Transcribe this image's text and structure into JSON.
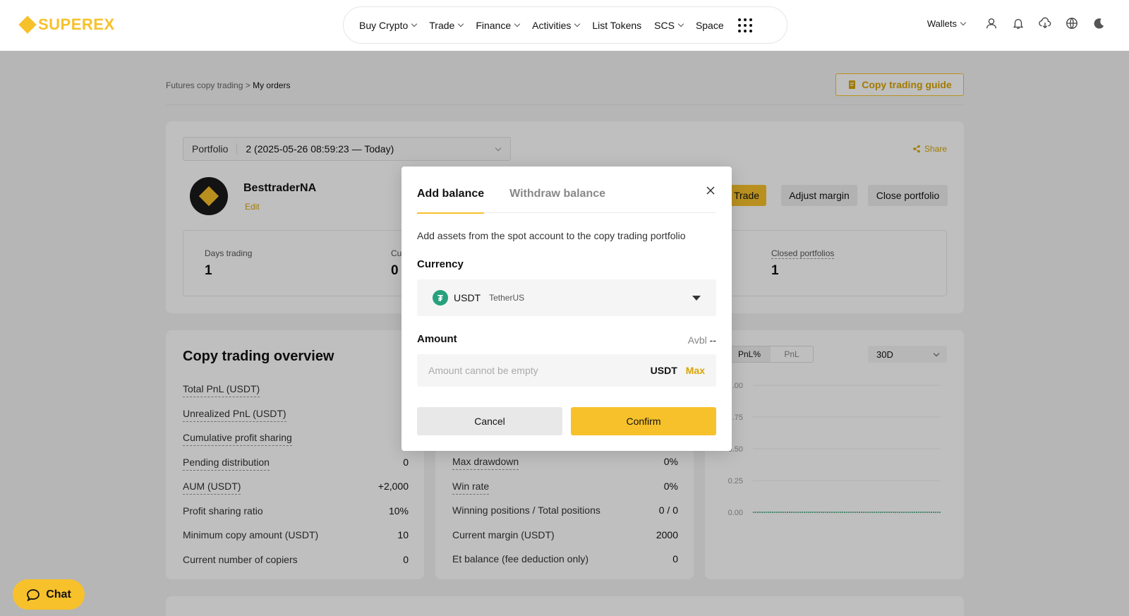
{
  "brand": {
    "name": "SUPEREX",
    "color": "#f7c12b"
  },
  "nav": {
    "items": [
      {
        "label": "Buy Crypto",
        "dropdown": true
      },
      {
        "label": "Trade",
        "dropdown": true
      },
      {
        "label": "Finance",
        "dropdown": true
      },
      {
        "label": "Activities",
        "dropdown": true
      },
      {
        "label": "List Tokens",
        "dropdown": false
      },
      {
        "label": "SCS",
        "dropdown": true
      },
      {
        "label": "Space",
        "dropdown": false
      }
    ],
    "wallets_label": "Wallets",
    "icons": [
      "user-icon",
      "bell-icon",
      "download-icon",
      "globe-icon",
      "moon-icon"
    ]
  },
  "breadcrumb": {
    "parent": "Futures copy trading",
    "sep": ">",
    "current": "My orders"
  },
  "guide_button": "Copy trading guide",
  "portfolio": {
    "label": "Portfolio",
    "value": "2  (2025-05-26 08:59:23 — Today)",
    "share": "Share"
  },
  "trader": {
    "name": "BesttraderNA",
    "edit": "Edit",
    "buttons": {
      "trade": "Trade",
      "adjust": "Adjust margin",
      "close": "Close portfolio"
    }
  },
  "stats": {
    "days_trading": {
      "label": "Days trading",
      "value": "1"
    },
    "current": {
      "label": "Cu",
      "value": "0"
    },
    "closed": {
      "label": "Closed portfolios",
      "value": "1"
    }
  },
  "overview": {
    "title": "Copy trading overview",
    "left_rows": [
      {
        "label": "Total PnL (USDT)",
        "value": "",
        "underline": true
      },
      {
        "label": "Unrealized PnL (USDT)",
        "value": "",
        "underline": true
      },
      {
        "label": "Cumulative profit sharing",
        "value": "",
        "underline": true
      },
      {
        "label": "Pending distribution",
        "value": "0",
        "underline": true
      },
      {
        "label": "AUM (USDT)",
        "value": "+2,000",
        "underline": true
      },
      {
        "label": "Profit sharing ratio",
        "value": "10%",
        "underline": false
      },
      {
        "label": "Minimum copy amount (USDT)",
        "value": "10",
        "underline": false
      },
      {
        "label": "Current number of copiers",
        "value": "0",
        "underline": false
      }
    ],
    "mid_rows": [
      {
        "label": "Max drawdown",
        "value": "0%",
        "underline": true
      },
      {
        "label": "Win rate",
        "value": "0%",
        "underline": true
      },
      {
        "label": "Winning positions / Total positions",
        "value": "0 / 0",
        "underline": false
      },
      {
        "label": "Current margin (USDT)",
        "value": "2000",
        "underline": false
      },
      {
        "label": "Et balance (fee deduction only)",
        "value": "0",
        "underline": false
      }
    ]
  },
  "chart_data": {
    "type": "line",
    "tabs": [
      "PnL%",
      "PnL"
    ],
    "active_tab": "PnL%",
    "range": "30D",
    "y_ticks": [
      ".00",
      ".75",
      "0.50",
      "0.25",
      "0.00"
    ],
    "series": [
      {
        "values": [
          0,
          0
        ]
      }
    ],
    "ylim": [
      0,
      1
    ],
    "line_color": "#3ba272"
  },
  "chat": {
    "label": "Chat"
  },
  "modal": {
    "tabs": [
      "Add balance",
      "Withdraw balance"
    ],
    "active_tab": 0,
    "description": "Add assets from the spot account to the copy trading portfolio",
    "currency_label": "Currency",
    "currency_code": "USDT",
    "currency_name": "TetherUS",
    "amount_label": "Amount",
    "avbl_label": "Avbl",
    "avbl_value": "--",
    "amount_placeholder": "Amount cannot be empty",
    "amount_unit": "USDT",
    "max_label": "Max",
    "cancel": "Cancel",
    "confirm": "Confirm"
  }
}
